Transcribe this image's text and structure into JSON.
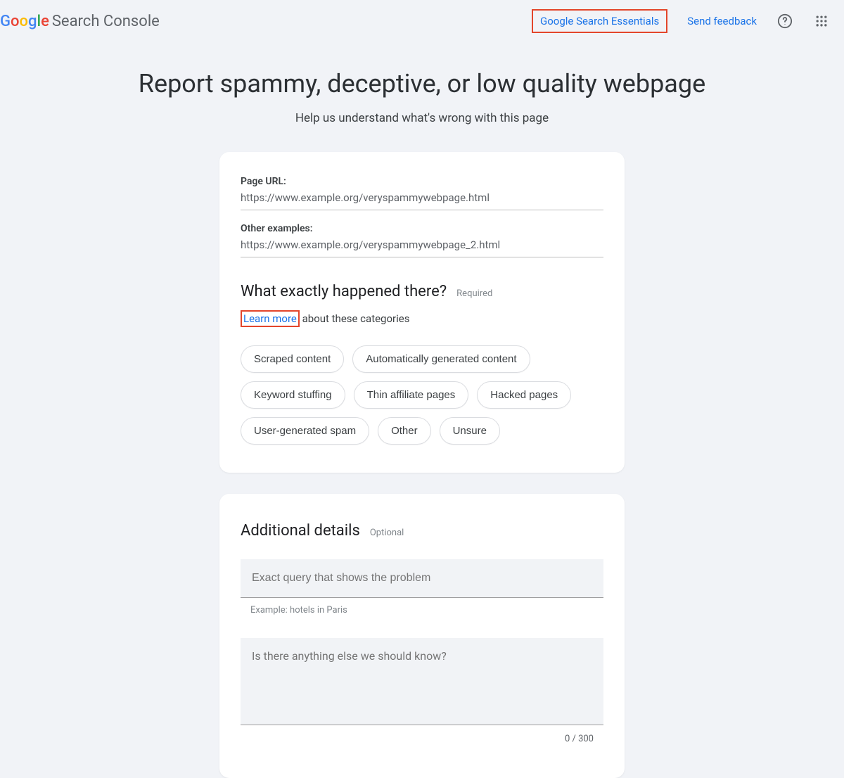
{
  "header": {
    "product_name": "Search Console",
    "essentials_link": "Google Search Essentials",
    "feedback_link": "Send feedback"
  },
  "title": {
    "main": "Report spammy, deceptive, or low quality webpage",
    "sub": "Help us understand what's wrong with this page"
  },
  "form": {
    "page_url_label": "Page URL:",
    "page_url_value": "https://www.example.org/veryspammywebpage.html",
    "other_examples_label": "Other examples:",
    "other_examples_value": "https://www.example.org/veryspammywebpage_2.html",
    "question_title": "What exactly happened there?",
    "required_tag": "Required",
    "learn_more": "Learn more",
    "learn_more_rest": " about these categories",
    "chips": [
      "Scraped content",
      "Automatically generated content",
      "Keyword stuffing",
      "Thin affiliate pages",
      "Hacked pages",
      "User-generated spam",
      "Other",
      "Unsure"
    ]
  },
  "details": {
    "title": "Additional details",
    "optional_tag": "Optional",
    "query_placeholder": "Exact query that shows the problem",
    "query_helper": "Example: hotels in Paris",
    "anything_else_placeholder": "Is there anything else we should know?",
    "counter": "0 / 300"
  }
}
